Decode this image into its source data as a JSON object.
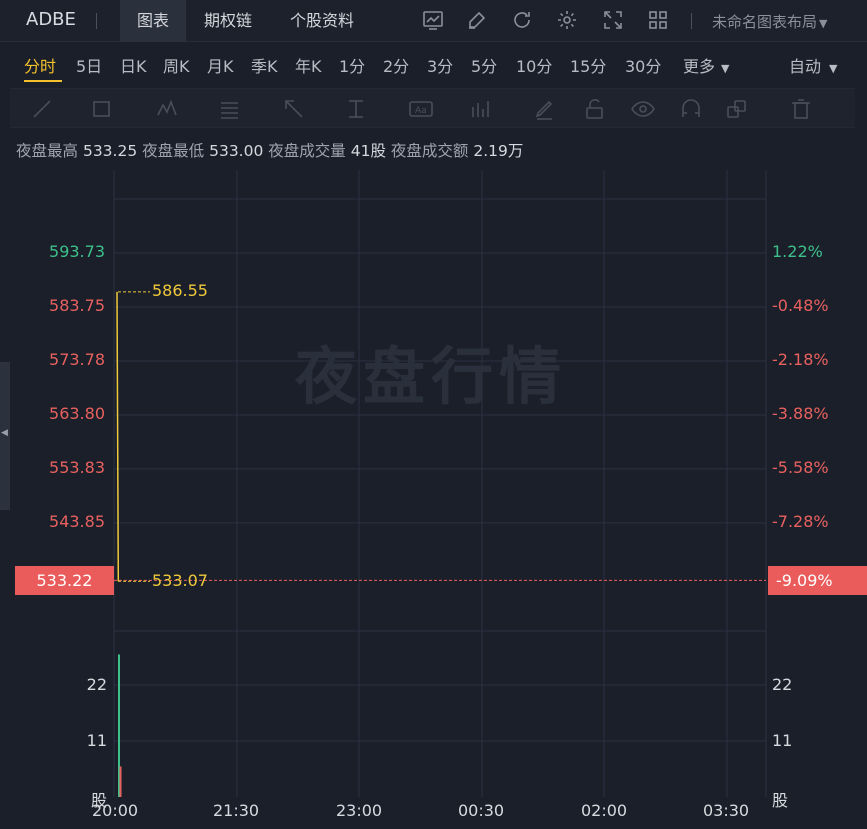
{
  "header": {
    "symbol": "ADBE",
    "tabs": [
      "图表",
      "期权链",
      "个股资料"
    ],
    "active_tab": 0,
    "layout_name": "未命名图表布局"
  },
  "periods": {
    "items": [
      "分时",
      "5日",
      "日K",
      "周K",
      "月K",
      "季K",
      "年K",
      "1分",
      "2分",
      "3分",
      "5分",
      "10分",
      "15分",
      "30分",
      "更多"
    ],
    "active": 0,
    "more_arrow": "caret-down-icon",
    "mode": "自动"
  },
  "drawing_tools": [
    "trendline-icon",
    "rectangle-icon",
    "pattern-icon",
    "fibonacci-icon",
    "arrow-icon",
    "measure-icon",
    "text-icon",
    "indicator-icon",
    "pencil-icon",
    "lock-icon",
    "eye-icon",
    "magnet-icon",
    "layers-icon",
    "trash-icon"
  ],
  "info": {
    "high_label": "夜盘最高",
    "high": "533.25",
    "low_label": "夜盘最低",
    "low": "533.00",
    "vol_label": "夜盘成交量",
    "vol": "41股",
    "amount_label": "夜盘成交额",
    "amount": "2.19万"
  },
  "watermark": "夜盘行情",
  "chart_data": {
    "type": "line",
    "price_axis_left": [
      "593.73",
      "583.75",
      "573.78",
      "563.80",
      "553.83",
      "543.85"
    ],
    "price_axis_right": [
      "1.22%",
      "-0.48%",
      "-2.18%",
      "-3.88%",
      "-5.58%",
      "-7.28%"
    ],
    "current_price": "533.22",
    "current_pct": "-9.09%",
    "annotation_high": "586.55",
    "annotation_low": "533.07",
    "volume_axis_left": [
      "22",
      "11",
      "股"
    ],
    "volume_axis_right": [
      "22",
      "11",
      "股"
    ],
    "x_ticks": [
      "20:00",
      "21:30",
      "23:00",
      "00:30",
      "02:00",
      "03:30"
    ],
    "series": [
      {
        "values": [
          [
            0,
            586.55
          ],
          [
            0.02,
            533.07
          ]
        ]
      }
    ],
    "volume_bars": [
      {
        "x": 0,
        "value": 28,
        "color": "#3ec08a"
      },
      {
        "x": 0.005,
        "value": 6,
        "color": "#e8615f"
      }
    ],
    "colors": {
      "up": "#3ec08a",
      "down": "#e8615f",
      "price_line": "#f0c93a",
      "grid": "#2b3240"
    }
  }
}
